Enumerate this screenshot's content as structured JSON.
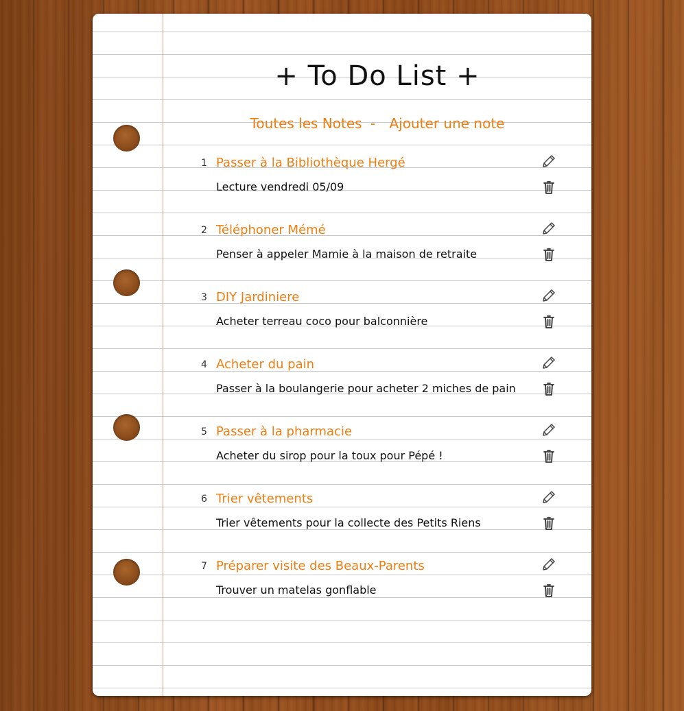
{
  "page": {
    "title": "+ To Do List +"
  },
  "nav": {
    "all_notes": "Toutes les Notes",
    "separator": "-",
    "add_note": "Ajouter une note"
  },
  "notes": [
    {
      "number": "1",
      "title": "Passer à la Bibliothèque Hergé",
      "description": "Lecture vendredi 05/09"
    },
    {
      "number": "2",
      "title": "Téléphoner Mémé",
      "description": "Penser à appeler Mamie à la maison de retraite"
    },
    {
      "number": "3",
      "title": "DIY Jardiniere",
      "description": "Acheter terreau coco pour balconnière"
    },
    {
      "number": "4",
      "title": "Acheter du pain",
      "description": "Passer à la boulangerie pour acheter 2 miches de pain"
    },
    {
      "number": "5",
      "title": "Passer à la pharmacie",
      "description": "Acheter du sirop pour la toux pour Pépé !"
    },
    {
      "number": "6",
      "title": "Trier vêtements",
      "description": "Trier vêtements pour la collecte des Petits Riens"
    },
    {
      "number": "7",
      "title": "Préparer visite des Beaux-Parents",
      "description": "Trouver un matelas gonflable"
    }
  ],
  "icons": {
    "edit": "pencil-icon",
    "delete": "trash-icon"
  },
  "colors": {
    "accent": "#f07d10",
    "ink": "#111111",
    "rule_line": "#c4c7cc",
    "margin_line": "#e6a28a",
    "wood": "#8a4a1c"
  }
}
